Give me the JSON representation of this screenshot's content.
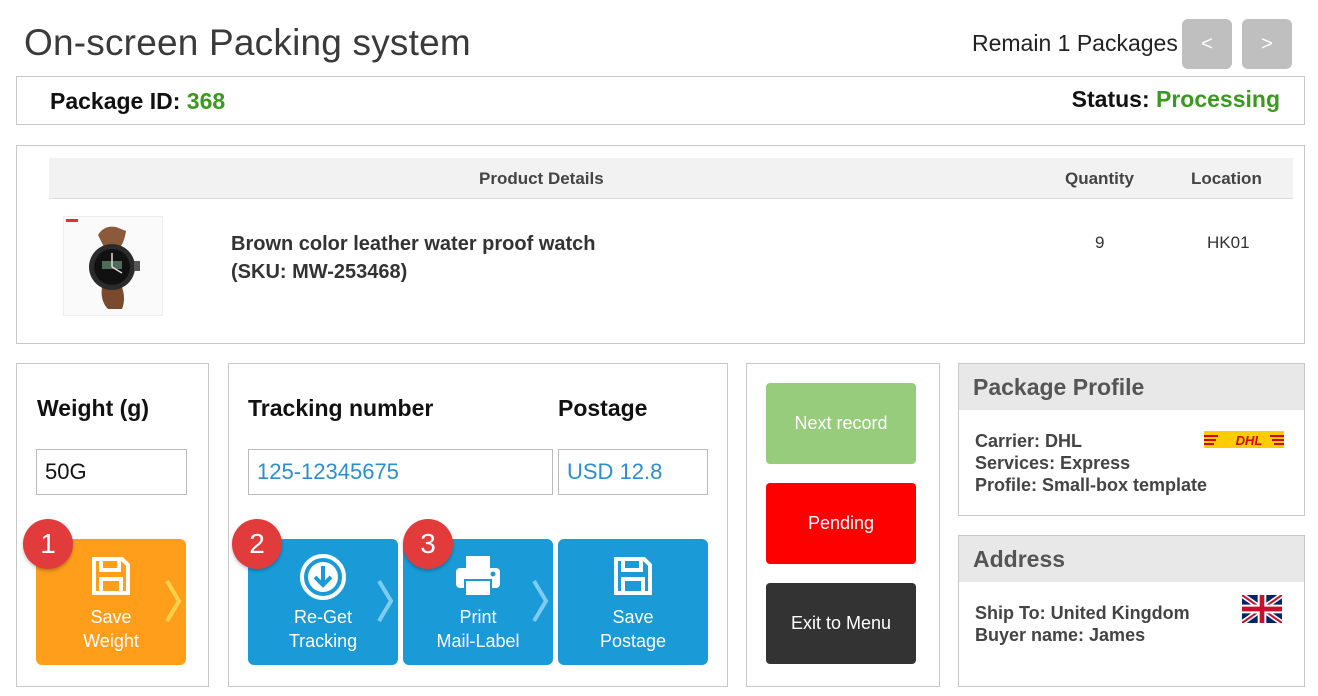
{
  "header": {
    "title": "On-screen Packing system",
    "remain_text": "Remain 1 Packages",
    "prev_label": "<",
    "next_label": ">"
  },
  "package": {
    "id_label": "Package ID:",
    "id_value": "368",
    "status_label": "Status:",
    "status_value": "Processing"
  },
  "table": {
    "headers": {
      "product": "Product Details",
      "quantity": "Quantity",
      "location": "Location"
    },
    "rows": [
      {
        "name": "Brown color leather water proof watch",
        "sku": "(SKU: MW-253468)",
        "quantity": "9",
        "location": "HK01"
      }
    ]
  },
  "weight": {
    "label": "Weight (g)",
    "value": "50G",
    "save_line1": "Save",
    "save_line2": "Weight",
    "step": "1"
  },
  "tracking": {
    "label": "Tracking number",
    "value": "125-12345675",
    "postage_label": "Postage",
    "postage_value": "USD 12.8",
    "reget_line1": "Re-Get",
    "reget_line2": "Tracking",
    "reget_step": "2",
    "print_line1": "Print",
    "print_line2": "Mail-Label",
    "print_step": "3",
    "savepost_line1": "Save",
    "savepost_line2": "Postage"
  },
  "actions": {
    "next_record": "Next record",
    "pending": "Pending",
    "exit": "Exit to Menu"
  },
  "profile": {
    "title": "Package Profile",
    "carrier": "Carrier: DHL",
    "services": "Services: Express",
    "profile": "Profile: Small-box template",
    "carrier_logo": "DHL"
  },
  "address": {
    "title": "Address",
    "ship_to": "Ship To: United Kingdom",
    "buyer": "Buyer name: James"
  },
  "colors": {
    "orange": "#ff9e1b",
    "blue": "#1a9ad6",
    "green_text": "#3a9a1e",
    "next_green": "#98cc7d",
    "pending_red": "#ff0000",
    "exit_dark": "#333333",
    "badge_red": "#e23b3b"
  },
  "icons": [
    "floppy-disk-icon",
    "download-circle-icon",
    "printer-icon",
    "chevron-right-icon",
    "dhl-logo",
    "uk-flag-icon",
    "watch-product-image"
  ]
}
